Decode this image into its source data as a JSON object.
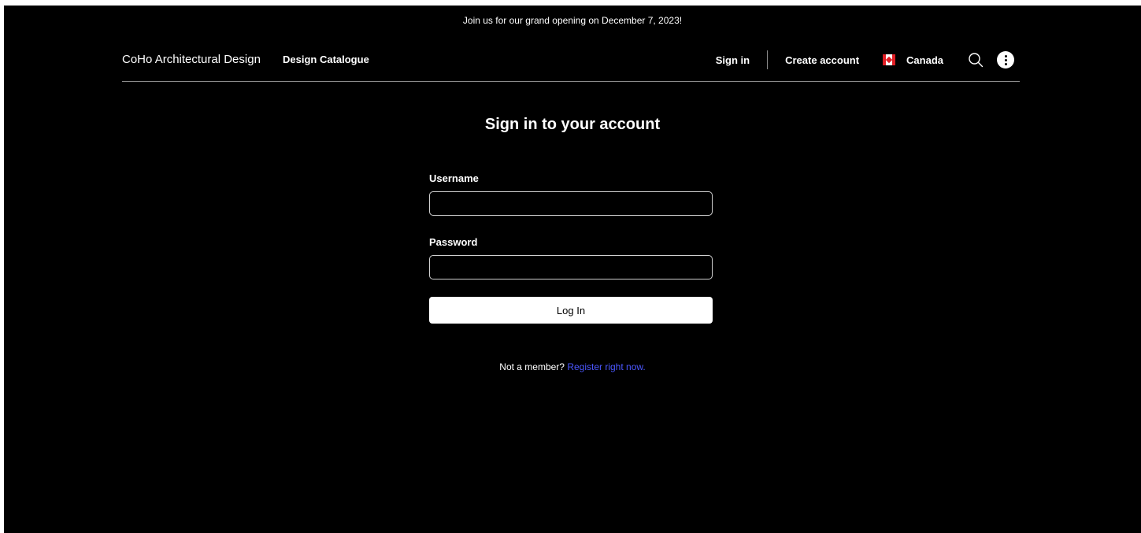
{
  "announcement": "Join us for our grand opening on December 7, 2023!",
  "header": {
    "brand": "CoHo Architectural Design",
    "catalogue_link": "Design Catalogue",
    "sign_in_link": "Sign in",
    "create_account_link": "Create account",
    "country": "Canada",
    "icons": {
      "search": "search-icon",
      "more": "more-options-icon",
      "flag": "canada-flag-icon"
    }
  },
  "form": {
    "title": "Sign in to your account",
    "username_label": "Username",
    "username_value": "",
    "password_label": "Password",
    "password_value": "",
    "login_button": "Log In"
  },
  "register": {
    "prompt": "Not a member?",
    "link": "Register right now."
  },
  "colors": {
    "background": "#000000",
    "text": "#ffffff",
    "link": "#4b57ff",
    "flag_red": "#e01e25"
  }
}
